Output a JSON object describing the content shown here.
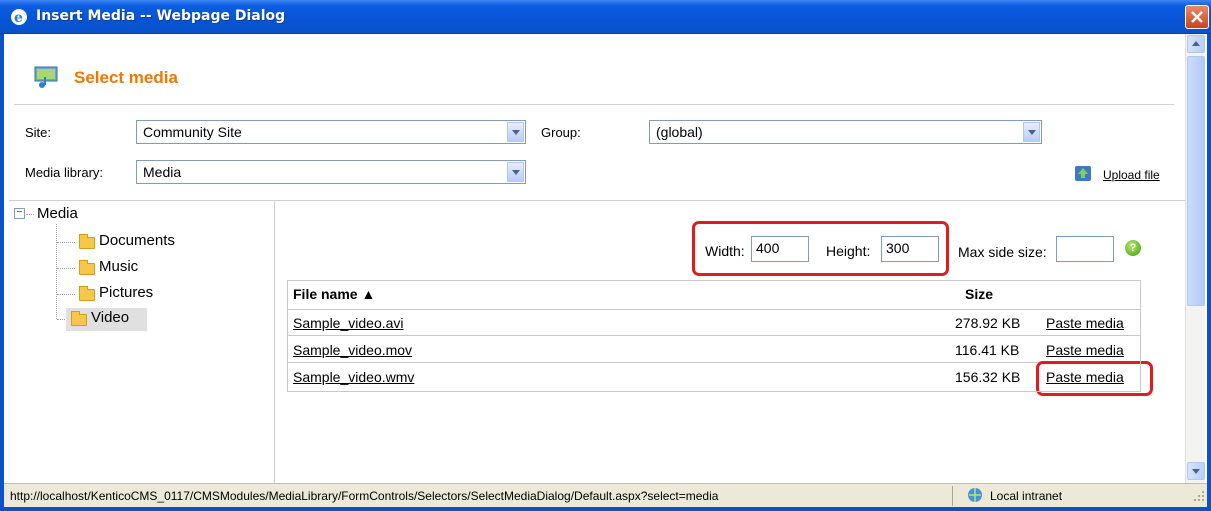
{
  "window": {
    "title": "Insert Media -- Webpage Dialog",
    "close_icon": "close-icon"
  },
  "header": {
    "title": "Select media"
  },
  "filters": {
    "site_label": "Site:",
    "site_value": "Community Site",
    "group_label": "Group:",
    "group_value": "(global)",
    "library_label": "Media library:",
    "library_value": "Media",
    "upload_label": "Upload file"
  },
  "tree": {
    "root": "Media",
    "items": [
      {
        "label": "Documents"
      },
      {
        "label": "Music"
      },
      {
        "label": "Pictures"
      },
      {
        "label": "Video",
        "selected": true
      }
    ]
  },
  "dimensions": {
    "width_label": "Width:",
    "width_value": "400",
    "height_label": "Height:",
    "height_value": "300",
    "max_label": "Max side size:",
    "max_value": "",
    "help": "?"
  },
  "grid": {
    "col_file": "File name ▲",
    "col_size": "Size",
    "rows": [
      {
        "name": "Sample_video.avi",
        "size": "278.92 KB",
        "action": "Paste media"
      },
      {
        "name": "Sample_video.mov",
        "size": "116.41 KB",
        "action": "Paste media"
      },
      {
        "name": "Sample_video.wmv",
        "size": "156.32 KB",
        "action": "Paste media"
      }
    ]
  },
  "status": {
    "url": "http://localhost/KenticoCMS_0117/CMSModules/MediaLibrary/FormControls/Selectors/SelectMediaDialog/Default.aspx?select=media",
    "zone": "Local intranet"
  },
  "colors": {
    "title_bar": "#0654d6",
    "header_title": "#f07800",
    "highlight": "#e21b1b"
  }
}
